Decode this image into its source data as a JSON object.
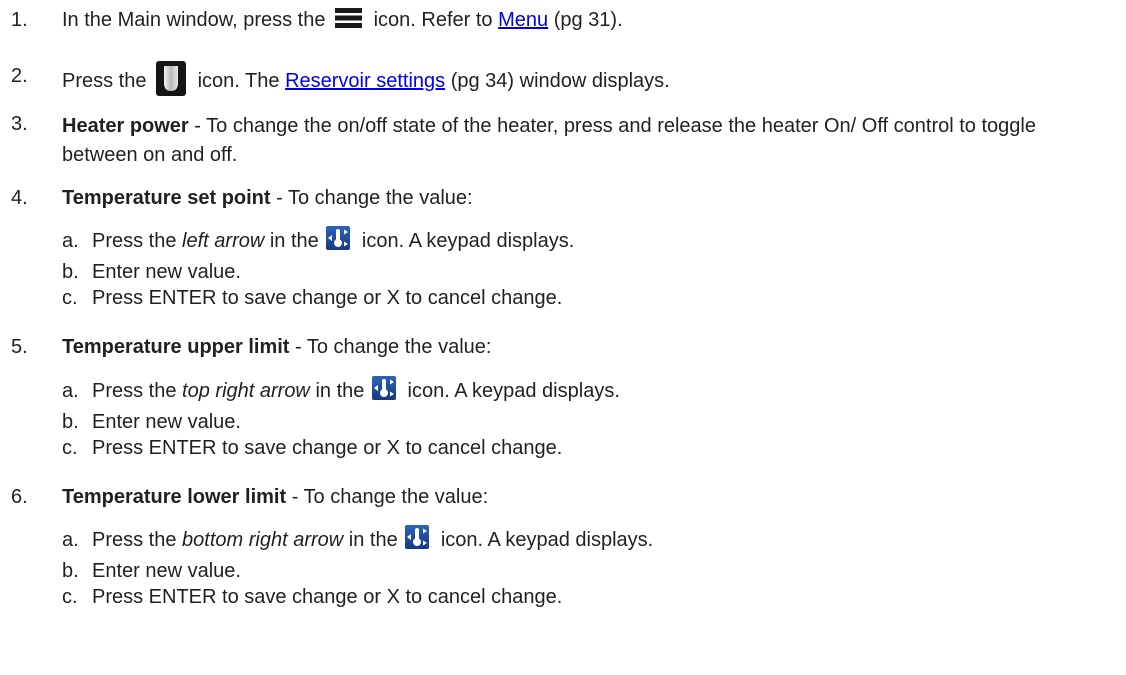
{
  "steps": [
    {
      "num": "1.",
      "a": "In the Main window, press the",
      "icon": "menu-icon",
      "b": "icon. Refer to",
      "link": "Menu",
      "c": "(pg 31)."
    },
    {
      "num": "2.",
      "a": "Press the",
      "icon": "reservoir-icon",
      "b": "icon. The",
      "link": "Reservoir settings",
      "c": "(pg 34) window displays."
    },
    {
      "num": "3.",
      "bold": "Heater power",
      "text": "- To change the on/off state of the heater, press and release the heater On/ Off control to toggle between on and off."
    },
    {
      "num": "4.",
      "bold": "Temperature set point",
      "text": "- To change the value:",
      "sub": [
        {
          "letter": "a.",
          "a": "Press the",
          "em": "left arrow",
          "b": "in the",
          "icon": "thermometer-icon",
          "c": "icon. A keypad displays."
        },
        {
          "letter": "b.",
          "text": "Enter new value."
        },
        {
          "letter": "c.",
          "text": "Press ENTER to save change or X to cancel change."
        }
      ]
    },
    {
      "num": "5.",
      "bold": "Temperature upper limit",
      "text": "- To change the value:",
      "sub": [
        {
          "letter": "a.",
          "a": "Press the",
          "em": "top right arrow",
          "b": "in the",
          "icon": "thermometer-icon",
          "c": "icon. A keypad displays."
        },
        {
          "letter": "b.",
          "text": "Enter new value."
        },
        {
          "letter": "c.",
          "text": "Press ENTER to save change or X to cancel change."
        }
      ]
    },
    {
      "num": "6.",
      "bold": "Temperature lower limit",
      "text": "- To change the value:",
      "sub": [
        {
          "letter": "a.",
          "a": "Press the",
          "em": "bottom right arrow",
          "b": "in the",
          "icon": "thermometer-icon",
          "c": "icon. A keypad displays."
        },
        {
          "letter": "b.",
          "text": "Enter new value."
        },
        {
          "letter": "c.",
          "text": "Press ENTER to save change or X to cancel change."
        }
      ]
    }
  ],
  "colors": {
    "text": "#231f20",
    "link": "#0000ee",
    "icon_dark": "#1a1a1a",
    "icon_blue": "#1f4e9c"
  }
}
